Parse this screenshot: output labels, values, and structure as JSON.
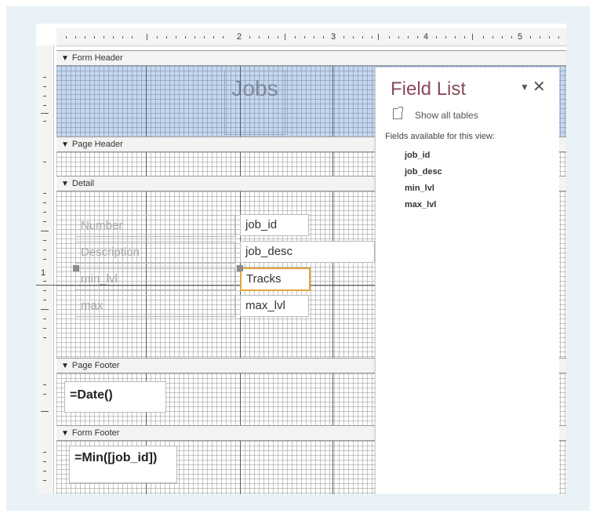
{
  "ruler": {
    "numbers": [
      "2",
      "3",
      "4",
      "5"
    ],
    "left_number": "1"
  },
  "sections": {
    "form_header": "Form Header",
    "page_header": "Page Header",
    "detail": "Detail",
    "page_footer": "Page Footer",
    "form_footer": "Form Footer"
  },
  "form_header": {
    "title": "Jobs"
  },
  "detail": {
    "labels": [
      "Number",
      "Description",
      "min_lvl",
      "max"
    ],
    "fields": [
      "job_id",
      "job_desc",
      "Tracks",
      "max_lvl"
    ]
  },
  "page_footer": {
    "expression": "=Date()"
  },
  "form_footer": {
    "expression": "=Min([job_id])"
  },
  "field_list": {
    "title": "Field List",
    "show_all": "Show all tables",
    "available_label": "Fields available for this view:",
    "fields": [
      "job_id",
      "job_desc",
      "min_lvl",
      "max_lvl"
    ]
  },
  "colors": {
    "header_band": "#c5d6ee",
    "selection": "#e3a53a",
    "field_list_title": "#8b4a5a"
  },
  "icons": [
    "section-arrow-icon",
    "show-all-tables-icon",
    "pin-dropdown-icon",
    "close-icon"
  ]
}
